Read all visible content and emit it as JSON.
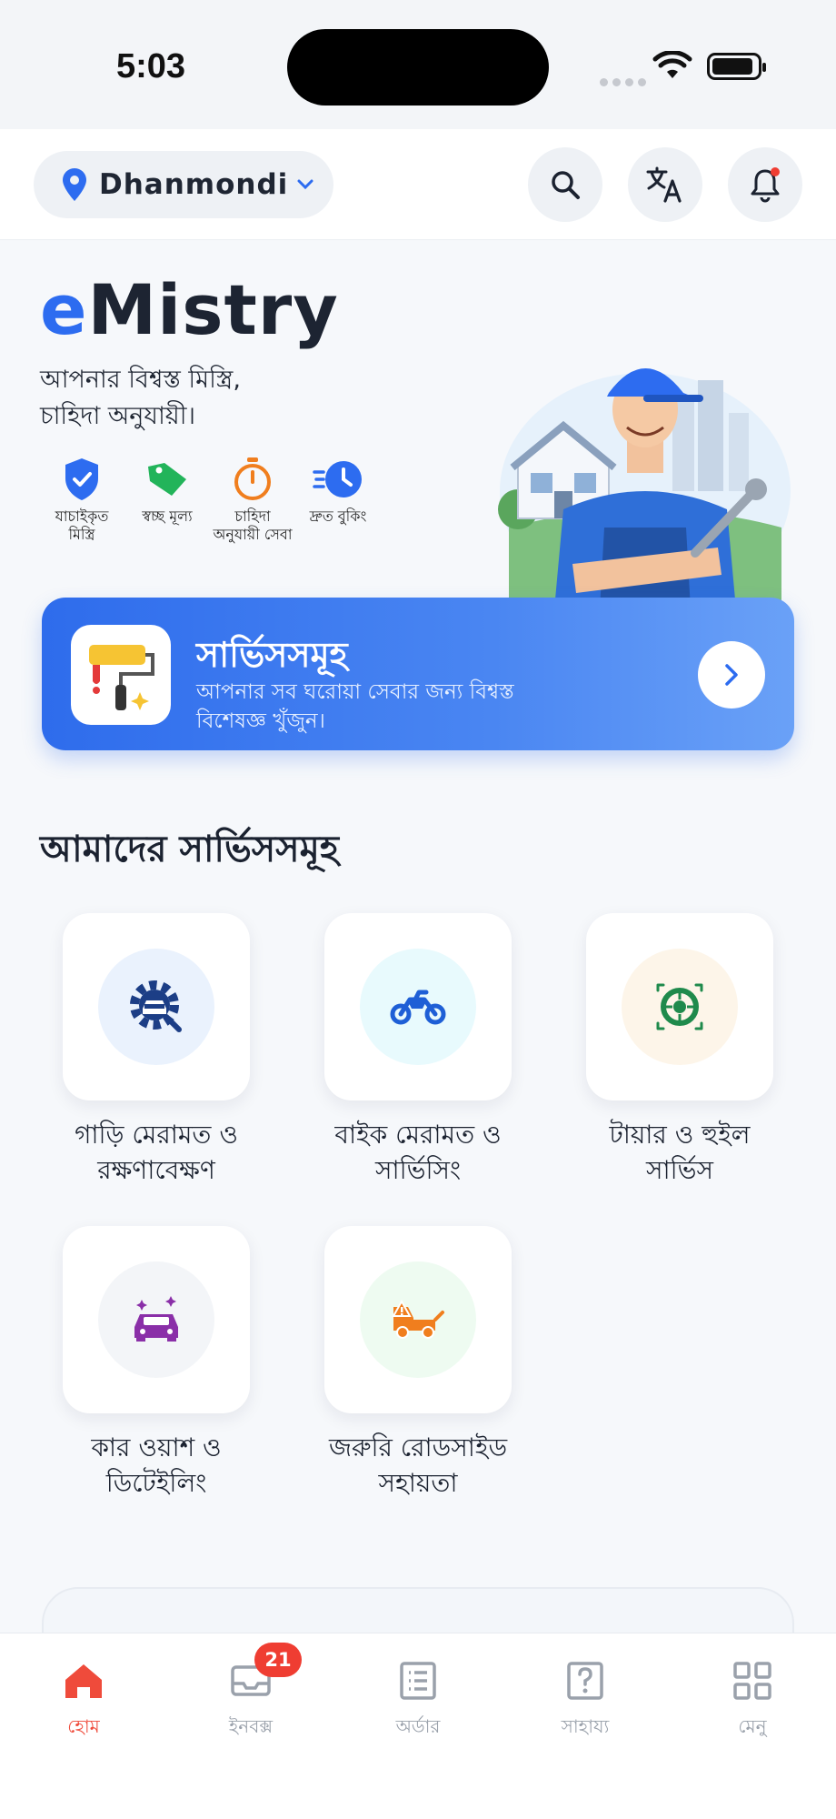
{
  "status_bar": {
    "time": "5:03"
  },
  "header": {
    "location": "Dhanmondi",
    "icons": [
      "location-pin-icon",
      "chevron-down-icon",
      "search-icon",
      "translate-icon",
      "bell-icon"
    ]
  },
  "hero": {
    "brand_e": "e",
    "brand_rest": "Mistry",
    "tagline_line1": "আপনার বিশ্বস্ত মিস্ত্রি,",
    "tagline_line2": "চাহিদা অনুযায়ী।",
    "features": [
      {
        "label": "যাচাইকৃত মিস্ত্রি",
        "icon": "shield-check-icon"
      },
      {
        "label": "স্বচ্ছ মূল্য",
        "icon": "price-tag-icon"
      },
      {
        "label": "চাহিদা অনুযায়ী সেবা",
        "icon": "stopwatch-icon"
      },
      {
        "label": "দ্রুত বুকিং",
        "icon": "fast-clock-icon"
      }
    ]
  },
  "banner": {
    "title": "সার্ভিসসমূহ",
    "subtitle": "আপনার সব ঘরোয়া সেবার জন্য বিশ্বস্ত বিশেষজ্ঞ খুঁজুন।"
  },
  "services_section": {
    "title": "আমাদের সার্ভিসসমূহ",
    "items": [
      {
        "line1": "গাড়ি মেরামত ও",
        "line2": "রক্ষণাবেক্ষণ",
        "icon": "car-repair-icon",
        "bg": "#eaf2fd"
      },
      {
        "line1": "বাইক মেরামত ও",
        "line2": "সার্ভিসিং",
        "icon": "motorbike-icon",
        "bg": "#e8fafd"
      },
      {
        "line1": "টায়ার ও হুইল",
        "line2": "সার্ভিস",
        "icon": "tire-wheel-icon",
        "bg": "#fdf5e9"
      },
      {
        "line1": "কার ওয়াশ ও",
        "line2": "ডিটেইলিং",
        "icon": "car-wash-icon",
        "bg": "#f3f5f8"
      },
      {
        "line1": "জরুরি রোডসাইড",
        "line2": "সহায়তা",
        "icon": "tow-truck-icon",
        "bg": "#eefbf1"
      }
    ]
  },
  "bottom_nav": {
    "items": [
      {
        "label": "হোম",
        "icon": "home-icon"
      },
      {
        "label": "ইনবক্স",
        "icon": "inbox-icon",
        "badge": "21"
      },
      {
        "label": "অর্ডার",
        "icon": "orders-list-icon"
      },
      {
        "label": "সাহায্য",
        "icon": "help-icon"
      },
      {
        "label": "মেনু",
        "icon": "menu-grid-icon"
      }
    ],
    "active_color": "#ef4b3b"
  },
  "colors": {
    "accent": "#2d6cf0",
    "badge": "#ef3d32"
  }
}
